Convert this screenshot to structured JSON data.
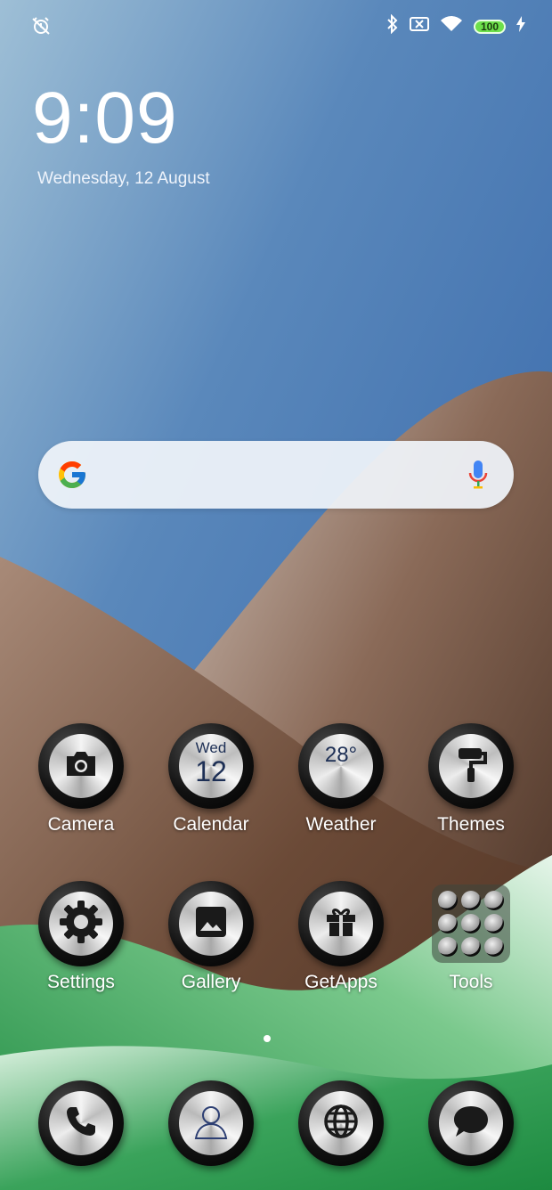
{
  "status_bar": {
    "left_icon": "alarm-off-icon",
    "right_icons": [
      "bluetooth-icon",
      "sim-off-icon",
      "wifi-icon"
    ],
    "battery": "100",
    "charging_icon": "charging-bolt-icon"
  },
  "clock": {
    "time": "9:09",
    "date": "Wednesday, 12 August"
  },
  "search": {
    "logo": "google-logo-icon",
    "mic": "mic-icon"
  },
  "apps": {
    "camera": {
      "label": "Camera",
      "icon": "camera-icon"
    },
    "calendar": {
      "label": "Calendar",
      "day": "Wed",
      "date": "12"
    },
    "weather": {
      "label": "Weather",
      "temp": "28°"
    },
    "themes": {
      "label": "Themes",
      "icon": "paint-roller-icon"
    },
    "settings": {
      "label": "Settings",
      "icon": "gear-icon"
    },
    "gallery": {
      "label": "Gallery",
      "icon": "image-icon"
    },
    "getapps": {
      "label": "GetApps",
      "icon": "gift-icon"
    },
    "tools": {
      "label": "Tools",
      "icon": "folder-icon"
    }
  },
  "dock": [
    {
      "icon": "phone-icon"
    },
    {
      "icon": "contacts-icon"
    },
    {
      "icon": "browser-globe-icon"
    },
    {
      "icon": "messages-icon"
    }
  ],
  "page_indicator": {
    "pages": 2,
    "current": 1
  },
  "colors": {
    "sky": "#3f6fa8",
    "hills": "#7a5a48",
    "grass": "#2f9a4e"
  }
}
